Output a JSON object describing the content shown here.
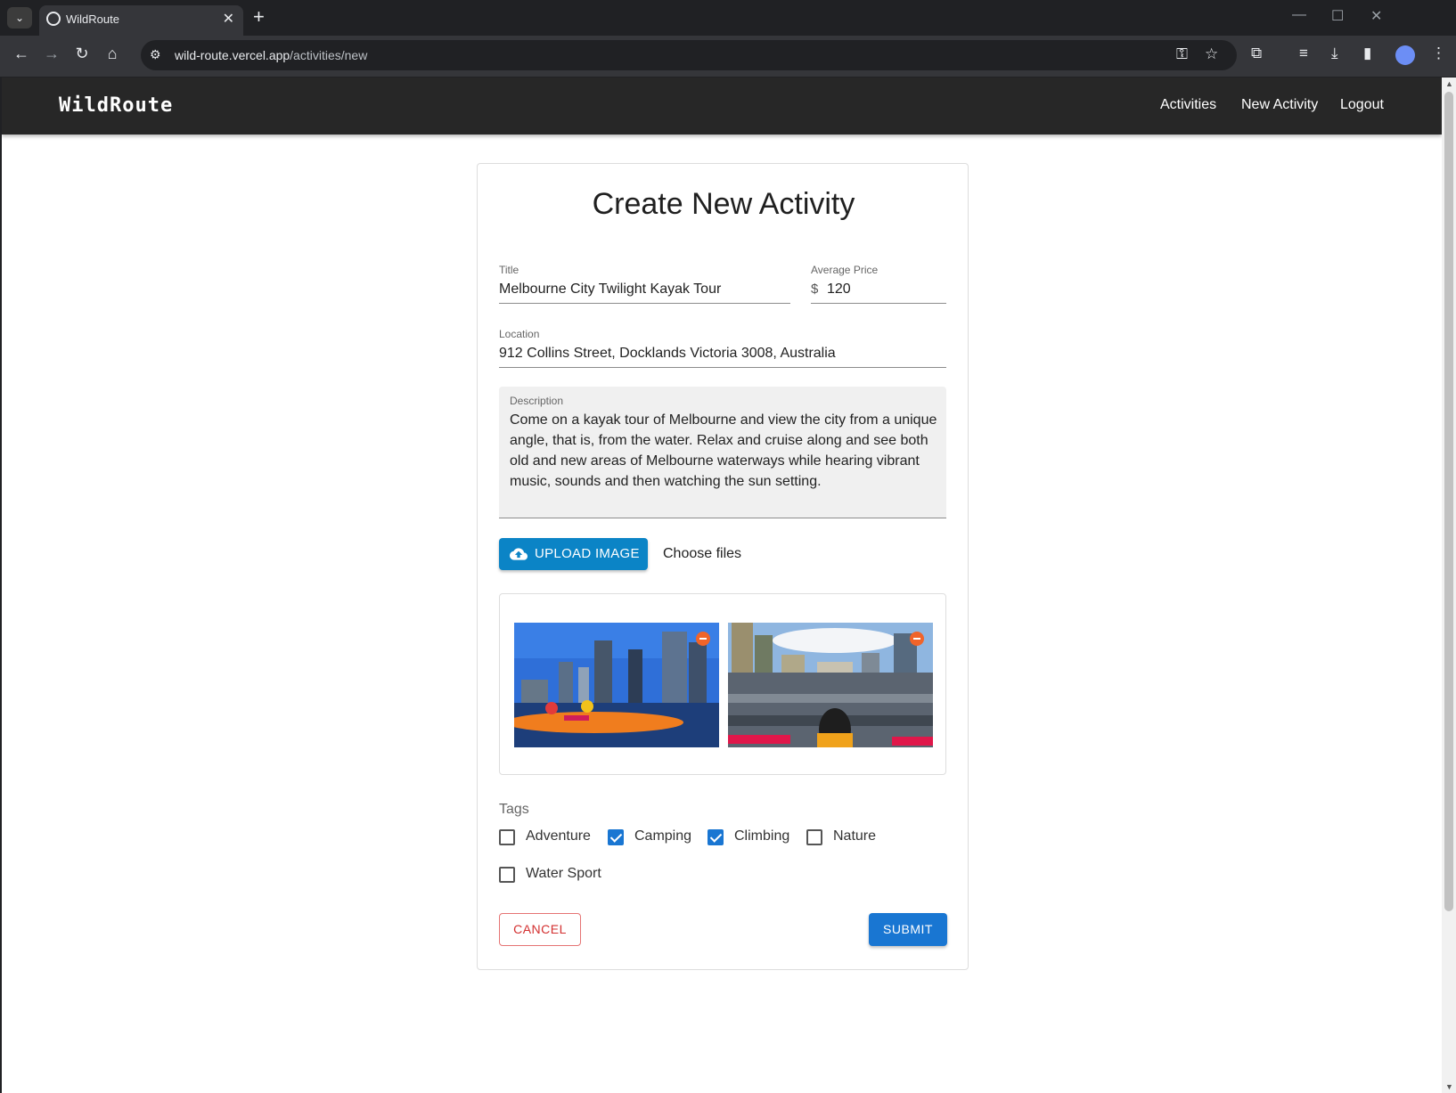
{
  "browser": {
    "tab_title": "WildRoute",
    "url_host": "wild-route.vercel.app",
    "url_path": "/activities/new",
    "new_tab_symbol": "+",
    "close_tab_symbol": "✕",
    "tab_list_symbol": "⌄"
  },
  "app": {
    "brand": "WildRoute",
    "nav": {
      "activities": "Activities",
      "new_activity": "New Activity",
      "logout": "Logout"
    }
  },
  "form": {
    "heading": "Create New Activity",
    "title": {
      "label": "Title",
      "value": "Melbourne City Twilight Kayak Tour"
    },
    "price": {
      "label": "Average Price",
      "prefix": "$",
      "value": "120"
    },
    "location": {
      "label": "Location",
      "value": "912 Collins Street, Docklands Victoria 3008, Australia"
    },
    "description": {
      "label": "Description",
      "value": "Come on a kayak tour of Melbourne and view the city from a unique angle, that is, from the water. Relax and cruise along and see both old and new areas of Melbourne waterways while hearing vibrant music, sounds and then watching the sun setting."
    },
    "upload_label": "UPLOAD IMAGE",
    "choose_files": "Choose files",
    "images_count": 2,
    "tags_label": "Tags",
    "tags": [
      {
        "label": "Adventure",
        "checked": false
      },
      {
        "label": "Camping",
        "checked": true
      },
      {
        "label": "Climbing",
        "checked": true
      },
      {
        "label": "Nature",
        "checked": false
      },
      {
        "label": "Water Sport",
        "checked": false
      }
    ],
    "cancel_label": "CANCEL",
    "submit_label": "SUBMIT"
  },
  "colors": {
    "appbar": "#272727",
    "primary": "#1976d2",
    "upload": "#0b84c6",
    "cancel": "#d32f2f",
    "remove": "#f0642a"
  },
  "icons": {
    "upload": "cloud-upload-icon",
    "remove": "remove-circle-icon"
  }
}
